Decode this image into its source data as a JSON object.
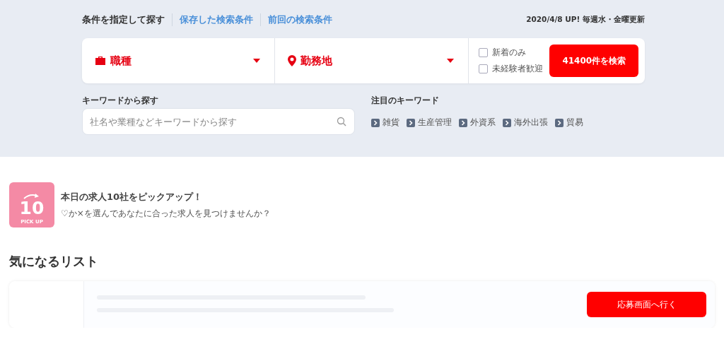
{
  "search_header": {
    "title": "条件を指定して探す",
    "links": [
      "保存した検索条件",
      "前回の検索条件"
    ],
    "update_note": "2020/4/8 UP! 毎週水・金曜更新"
  },
  "search_bar": {
    "selects": [
      {
        "kind": "job",
        "label": "職種"
      },
      {
        "kind": "location",
        "label": "勤務地"
      }
    ],
    "checkboxes": [
      {
        "label": "新着のみ",
        "checked": false
      },
      {
        "label": "未経験者歓迎",
        "checked": false
      }
    ],
    "submit": "41400件を検索"
  },
  "keyword_search": {
    "label": "キーワードから探す",
    "placeholder": "社名や業種などキーワードから探す"
  },
  "featured_keywords": {
    "label": "注目のキーワード",
    "items": [
      "雑貨",
      "生産管理",
      "外資系",
      "海外出張",
      "貿易"
    ]
  },
  "pickup": {
    "badge_number": "10",
    "badge_caption": "PICK UP",
    "title": "本日の求人10社をピックアップ！",
    "subtitle": "♡か×を選んであなたに合った求人を見つけませんか？"
  },
  "favorites": {
    "title": "気になるリスト",
    "apply_button": "応募画面へ行く"
  }
}
